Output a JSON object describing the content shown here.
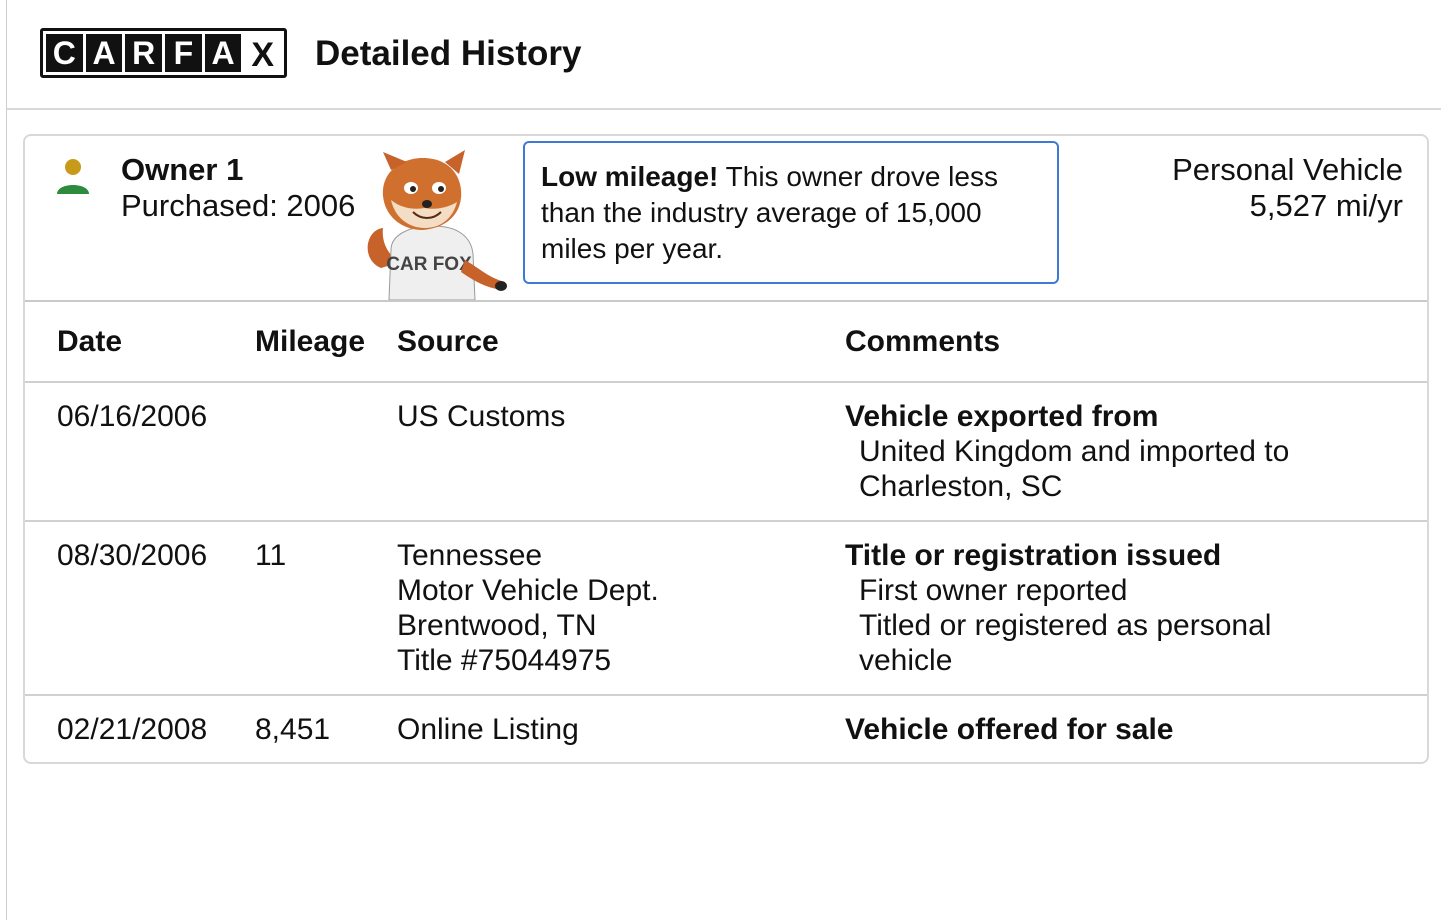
{
  "header": {
    "logo_letters": [
      "C",
      "A",
      "R",
      "F",
      "A",
      "X"
    ],
    "title": "Detailed History"
  },
  "owner": {
    "name": "Owner 1",
    "purchased": "Purchased: 2006",
    "icon": "person-icon",
    "icon_colors": {
      "head": "#c79a1a",
      "body": "#2e8b3e"
    },
    "mascot_shirt_text": "CAR FOX"
  },
  "callout": {
    "bold": "Low mileage!",
    "text": " This owner drove less than the industry average of 15,000 miles per year.",
    "border_color": "#3c7ad6"
  },
  "vehicle": {
    "type": "Personal Vehicle",
    "annual_mileage": "5,527 mi/yr"
  },
  "table": {
    "headers": {
      "date": "Date",
      "mileage": "Mileage",
      "source": "Source",
      "comments": "Comments"
    },
    "rows": [
      {
        "date": "06/16/2006",
        "mileage": "",
        "source": [
          "US Customs"
        ],
        "comment_head": "Vehicle exported from",
        "comment_lines": [
          "United Kingdom and imported to",
          "Charleston, SC"
        ]
      },
      {
        "date": "08/30/2006",
        "mileage": "11",
        "source": [
          "Tennessee",
          "Motor Vehicle Dept.",
          "Brentwood, TN",
          "Title #75044975"
        ],
        "comment_head": "Title or registration issued",
        "comment_lines": [
          "First owner reported",
          "Titled or registered as personal",
          "vehicle"
        ]
      },
      {
        "date": "02/21/2008",
        "mileage": "8,451",
        "source": [
          "Online Listing"
        ],
        "comment_head": "Vehicle offered for sale",
        "comment_lines": []
      }
    ]
  }
}
